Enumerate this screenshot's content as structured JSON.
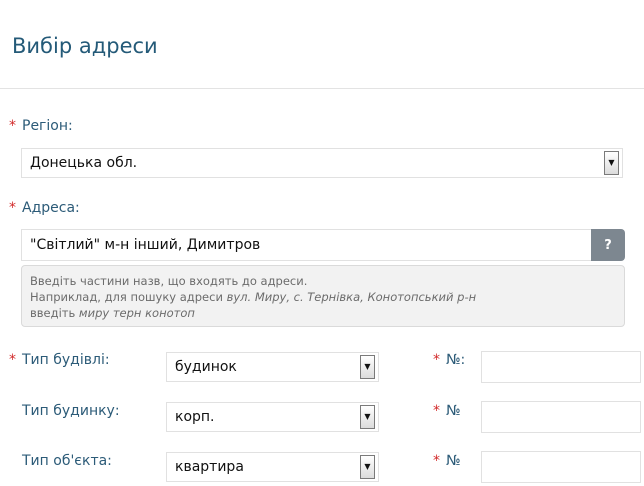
{
  "page": {
    "title": "Вибір адреси"
  },
  "form": {
    "required_marker": "*",
    "region": {
      "label": "Регіон:",
      "value": "Донецька обл.",
      "arrow_icon": "▼"
    },
    "address": {
      "label": "Адреса:",
      "value": "\"Світлий\" м-н інший, Димитров",
      "help_label": "?",
      "hint": {
        "line1": "Введіть частини назв, що входять до адреси.",
        "line2_prefix": "Наприклад, для пошуку адреси ",
        "line2_example": "вул. Миру, с. Тернівка, Конотопський р-н",
        "line3_prefix": "введіть ",
        "line3_example": "миру терн конотоп"
      }
    },
    "building_type": {
      "label": "Тип будівлі:",
      "value": "будинок",
      "number_label": "№:",
      "number_value": ""
    },
    "house_type": {
      "label": "Тип будинку:",
      "value": "корп.",
      "number_label": "№",
      "number_value": ""
    },
    "object_type": {
      "label": "Тип об'єкта:",
      "value": "квартира",
      "number_label": "№",
      "number_value": ""
    }
  },
  "colors": {
    "title": "#245a78",
    "label": "#2c5b78",
    "required": "#d22a2a",
    "help_button": "#7d8790",
    "hint_background": "#f2f2f2"
  }
}
